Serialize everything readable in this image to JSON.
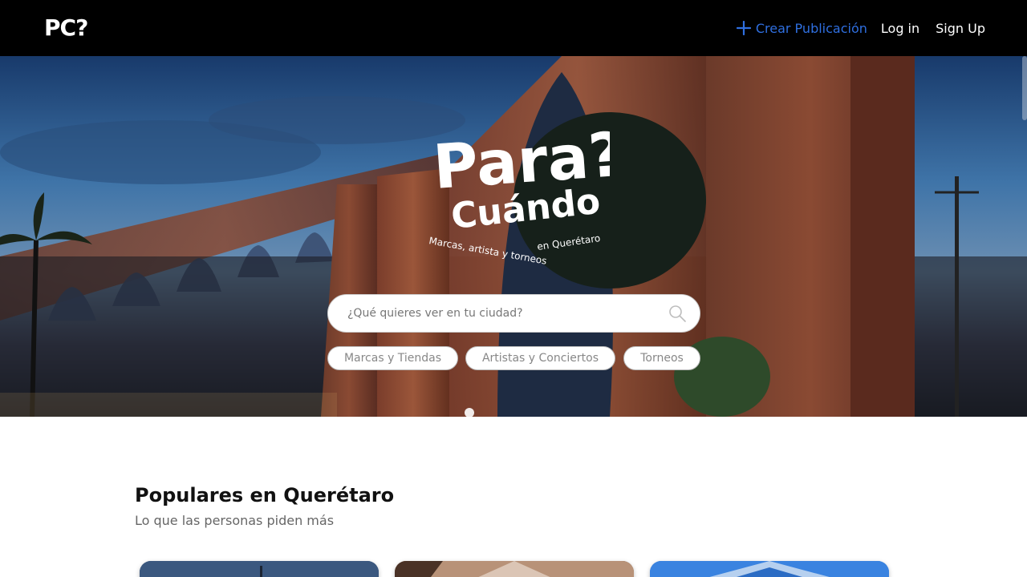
{
  "nav": {
    "logo": "PC?",
    "create_label": "Crear Publicación",
    "login_label": "Log in",
    "signup_label": "Sign Up",
    "create_icon": "plus-icon",
    "accent_color": "#2f6fe0"
  },
  "hero": {
    "logo_line1": "Para?",
    "logo_line2": "Cuándo",
    "tagline_part1": "Marcas, artista y torneos",
    "tagline_part2": "en Querétaro",
    "search": {
      "placeholder": "¿Qué quieres ver en tu ciudad?",
      "icon": "search-icon"
    },
    "chips": [
      "Marcas y Tiendas",
      "Artistas y Conciertos",
      "Torneos"
    ]
  },
  "section": {
    "title": "Populares en Querétaro",
    "subtitle": "Lo que las personas piden más"
  }
}
